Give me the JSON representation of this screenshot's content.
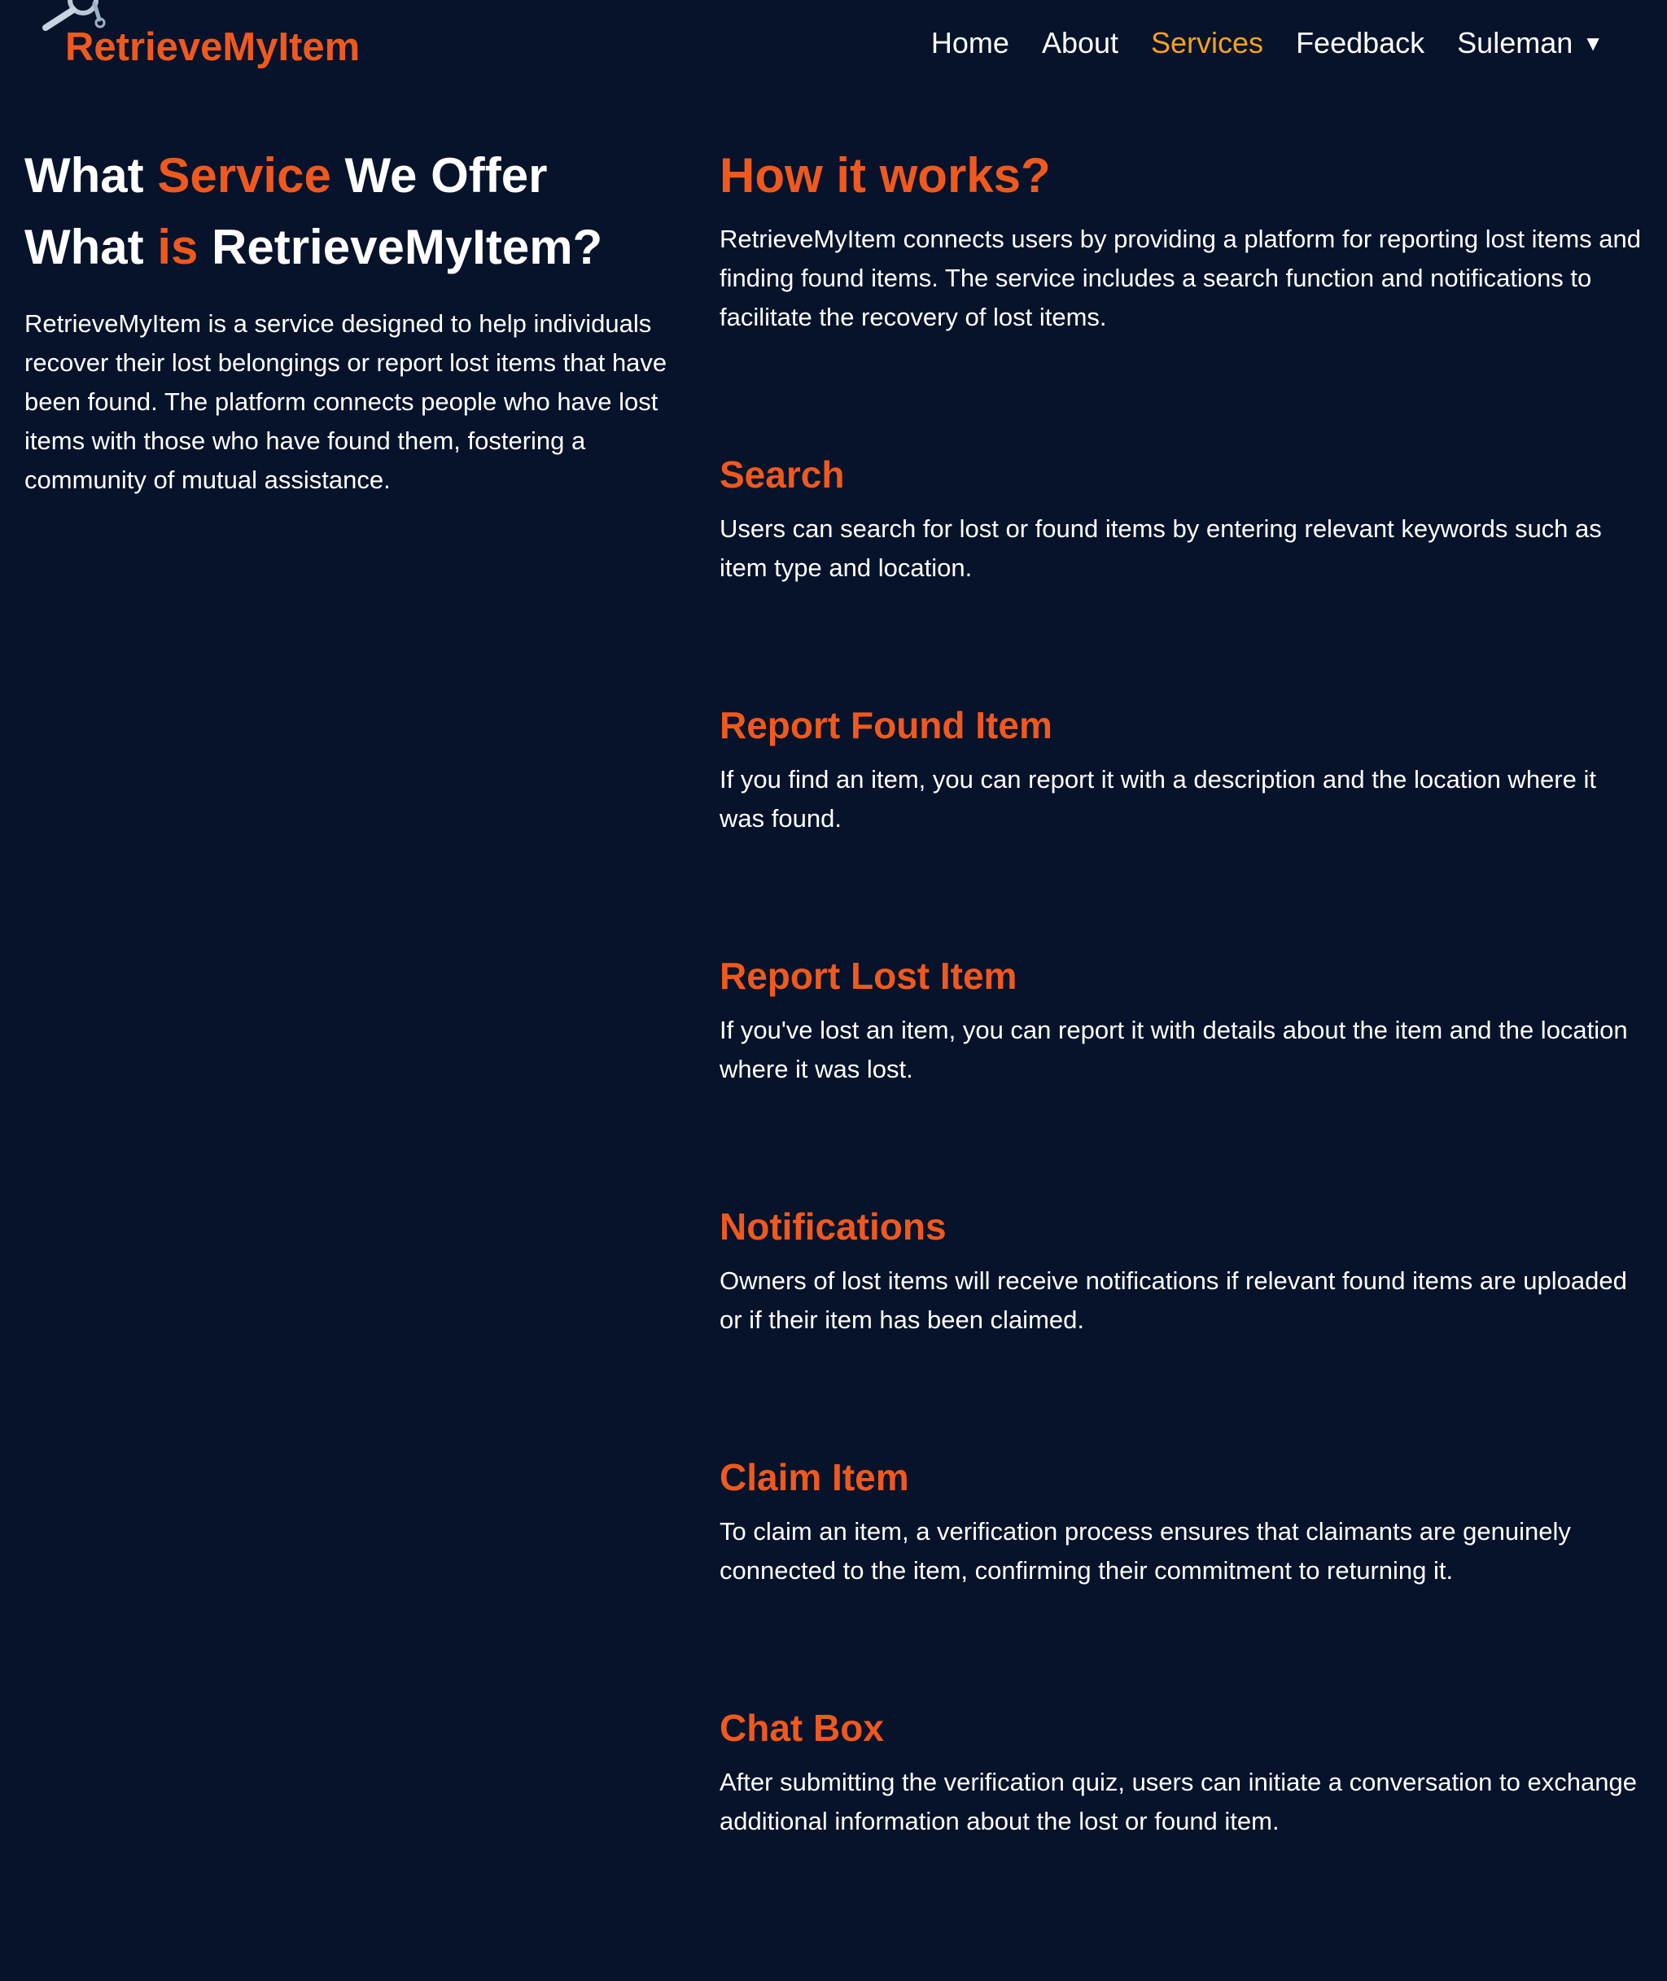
{
  "nav": {
    "logo_text": "RetrieveMyItem",
    "links": [
      {
        "label": "Home"
      },
      {
        "label": "About"
      },
      {
        "label": "Services"
      },
      {
        "label": "Feedback"
      }
    ],
    "active_link": "Services",
    "user_name": "Suleman",
    "user_caret": "▼"
  },
  "left": {
    "title_line1": {
      "part1": "What ",
      "accent": "Service",
      "part2": " We Offer"
    },
    "title_line2": {
      "part1": "What ",
      "accent": "is",
      "part2": " RetrieveMyItem?"
    },
    "paragraph": "RetrieveMyItem is a service designed to help individuals recover their lost belongings or report lost items that have been found. The platform connects people who have lost items with those who have found them, fostering a community of mutual assistance."
  },
  "right": {
    "how_title": "How it works?",
    "how_paragraph": "RetrieveMyItem connects users by providing a platform for reporting lost items and finding found items. The service includes a search function and notifications to facilitate the recovery of lost items.",
    "services": [
      {
        "title": "Search",
        "description": "Users can search for lost or found items by entering relevant keywords such as item type and location."
      },
      {
        "title": "Report Found Item",
        "description": "If you find an item, you can report it with a description and the location where it was found."
      },
      {
        "title": "Report Lost Item",
        "description": "If you've lost an item, you can report it with details about the item and the location where it was lost."
      },
      {
        "title": "Notifications",
        "description": "Owners of lost items will receive notifications if relevant found items are uploaded or if their item has been claimed."
      },
      {
        "title": "Claim Item",
        "description": "To claim an item, a verification process ensures that claimants are genuinely connected to the item, confirming their commitment to returning it."
      },
      {
        "title": "Chat Box",
        "description": "After submitting the verification quiz, users can initiate a conversation to exchange additional information about the lost or found item."
      }
    ]
  },
  "colors": {
    "background": "#06132b",
    "accent": "#f0591e",
    "active_nav": "#f6a11c",
    "text": "#ffffff"
  },
  "icons": {
    "logo_icon": "magnifier-key-icon"
  }
}
